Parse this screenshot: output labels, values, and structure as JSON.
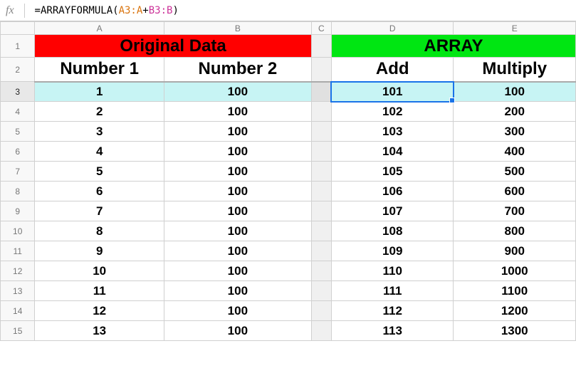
{
  "formula_bar": {
    "fx": "fx",
    "formula_prefix": "=",
    "formula_fn": "ARRAYFORMULA",
    "formula_open": "(",
    "formula_r1": "A3:A",
    "formula_plus": "+",
    "formula_r2": "B3:B",
    "formula_close": ")"
  },
  "columns": {
    "a": "A",
    "b": "B",
    "c": "C",
    "d": "D",
    "e": "E"
  },
  "headers": {
    "original_data": "Original Data",
    "array": "ARRAY",
    "num1": "Number 1",
    "num2": "Number 2",
    "add": "Add",
    "multiply": "Multiply"
  },
  "selected_cell_ref": "D3",
  "chart_data": {
    "type": "table",
    "rows": [
      {
        "n": "3",
        "a": "1",
        "b": "100",
        "d": "101",
        "e": "100"
      },
      {
        "n": "4",
        "a": "2",
        "b": "100",
        "d": "102",
        "e": "200"
      },
      {
        "n": "5",
        "a": "3",
        "b": "100",
        "d": "103",
        "e": "300"
      },
      {
        "n": "6",
        "a": "4",
        "b": "100",
        "d": "104",
        "e": "400"
      },
      {
        "n": "7",
        "a": "5",
        "b": "100",
        "d": "105",
        "e": "500"
      },
      {
        "n": "8",
        "a": "6",
        "b": "100",
        "d": "106",
        "e": "600"
      },
      {
        "n": "9",
        "a": "7",
        "b": "100",
        "d": "107",
        "e": "700"
      },
      {
        "n": "10",
        "a": "8",
        "b": "100",
        "d": "108",
        "e": "800"
      },
      {
        "n": "11",
        "a": "9",
        "b": "100",
        "d": "109",
        "e": "900"
      },
      {
        "n": "12",
        "a": "10",
        "b": "100",
        "d": "110",
        "e": "1000"
      },
      {
        "n": "13",
        "a": "11",
        "b": "100",
        "d": "111",
        "e": "1100"
      },
      {
        "n": "14",
        "a": "12",
        "b": "100",
        "d": "112",
        "e": "1200"
      },
      {
        "n": "15",
        "a": "13",
        "b": "100",
        "d": "113",
        "e": "1300"
      }
    ]
  },
  "row_labels": {
    "r1": "1",
    "r2": "2"
  }
}
